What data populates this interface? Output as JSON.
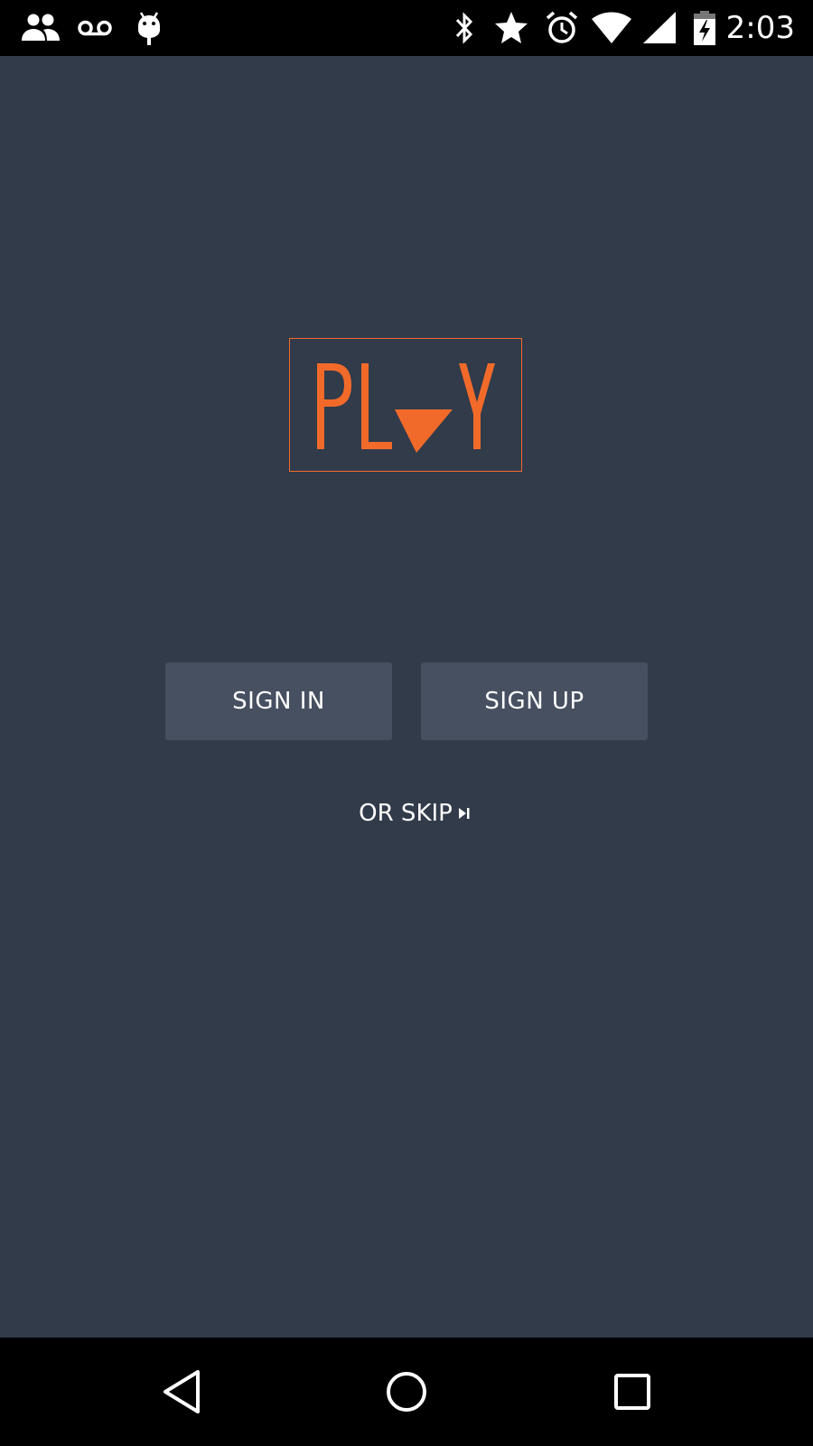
{
  "status_bar": {
    "time": "2:03",
    "left_icons": [
      "people-icon",
      "voicemail-icon",
      "android-debug-icon"
    ],
    "right_icons": [
      "bluetooth-icon",
      "star-icon",
      "alarm-icon",
      "wifi-icon",
      "cell-signal-icon",
      "battery-charging-icon"
    ]
  },
  "logo": {
    "text": "PLAY",
    "accent_color": "#f26a2a"
  },
  "actions": {
    "sign_in_label": "SIGN IN",
    "sign_up_label": "SIGN UP",
    "skip_label": "OR SKIP"
  },
  "nav_bar": {
    "icons": [
      "back-icon",
      "home-icon",
      "recents-icon"
    ]
  },
  "colors": {
    "background": "#313b4a",
    "button": "#475061",
    "accent": "#f26a2a",
    "bars": "#000000"
  }
}
